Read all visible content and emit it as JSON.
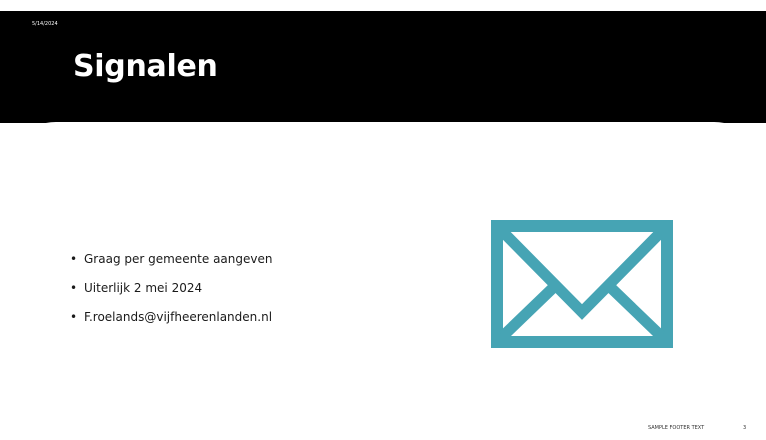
{
  "slide": {
    "date": "5/14/2024",
    "title": "Signalen",
    "bullets": [
      "Graag per gemeente aangeven",
      "Uiterlijk 2 mei 2024",
      "F.roelands@vijfheerenlanden.nl"
    ],
    "icon": "envelope-icon",
    "footer": "SAMPLE FOOTER TEXT",
    "page_number": "3"
  },
  "colors": {
    "header_background": "#000000",
    "envelope": "#46a4b4"
  }
}
